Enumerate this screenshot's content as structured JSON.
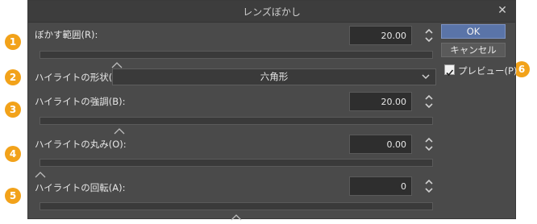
{
  "dialog": {
    "title": "レンズぼかし"
  },
  "fields": [
    {
      "label": "ぼかす範囲(R):",
      "value": "20.00",
      "slider": 0.2
    },
    {
      "label": "ハイライトの形状(S):",
      "select": "六角形"
    },
    {
      "label": "ハイライトの強調(B):",
      "value": "20.00",
      "slider": 0.2
    },
    {
      "label": "ハイライトの丸み(O):",
      "value": "0.00",
      "slider": 0.0
    },
    {
      "label": "ハイライトの回転(A):",
      "value": "0",
      "slider": 0.5
    }
  ],
  "buttons": {
    "ok": "OK",
    "cancel": "キャンセル"
  },
  "preview": {
    "label": "プレビュー(P)",
    "checked": true
  },
  "badges": [
    "1",
    "2",
    "3",
    "4",
    "5",
    "6"
  ],
  "colors": {
    "badge": "#f2a21a",
    "ok_button": "#5a74a8",
    "dialog_bg": "#4a4a4a"
  }
}
